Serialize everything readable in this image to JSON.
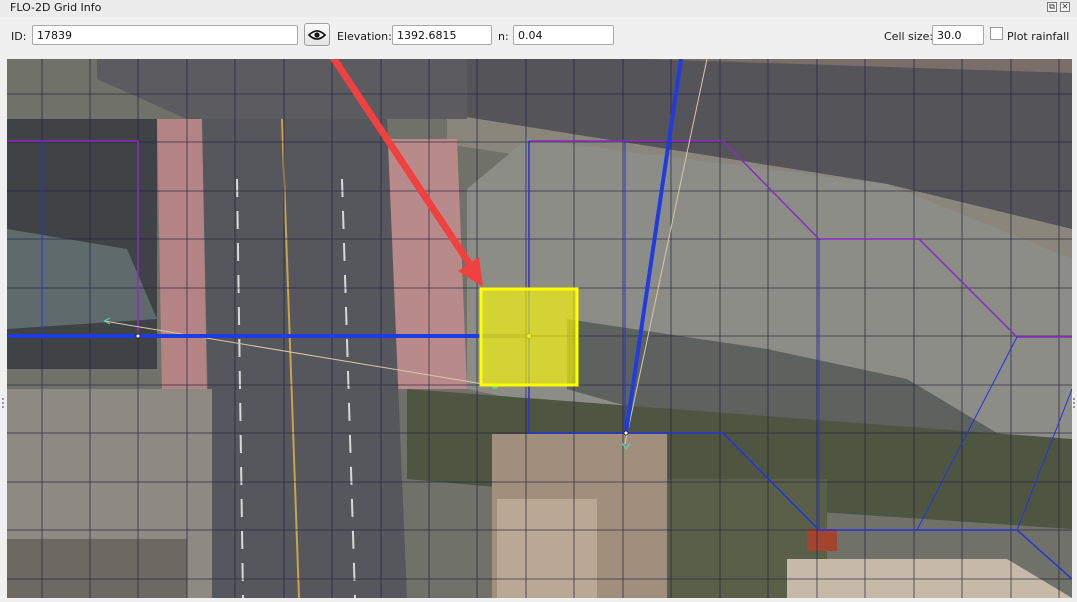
{
  "window": {
    "title": "FLO-2D Grid Info",
    "float_glyph": "⧉",
    "close_glyph": "✕"
  },
  "toolbar": {
    "id_label": "ID:",
    "id_value": "17839",
    "eye_button_icon": "eye-icon",
    "elevation_label": "Elevation:",
    "elevation_value": "1392.6815",
    "n_label": "n:",
    "n_value": "0.04",
    "cell_size_label": "Cell size:",
    "cell_size_value": "30.0",
    "plot_rainfall_label": "Plot rainfall",
    "plot_rainfall_checked": false
  },
  "map": {
    "selected_cell_color": "#ffff00",
    "arrow_color": "#f04040",
    "blue_line_color": "#2233dd",
    "purple_line_color": "#8a2dbf",
    "grid_line_color": "#202040"
  }
}
